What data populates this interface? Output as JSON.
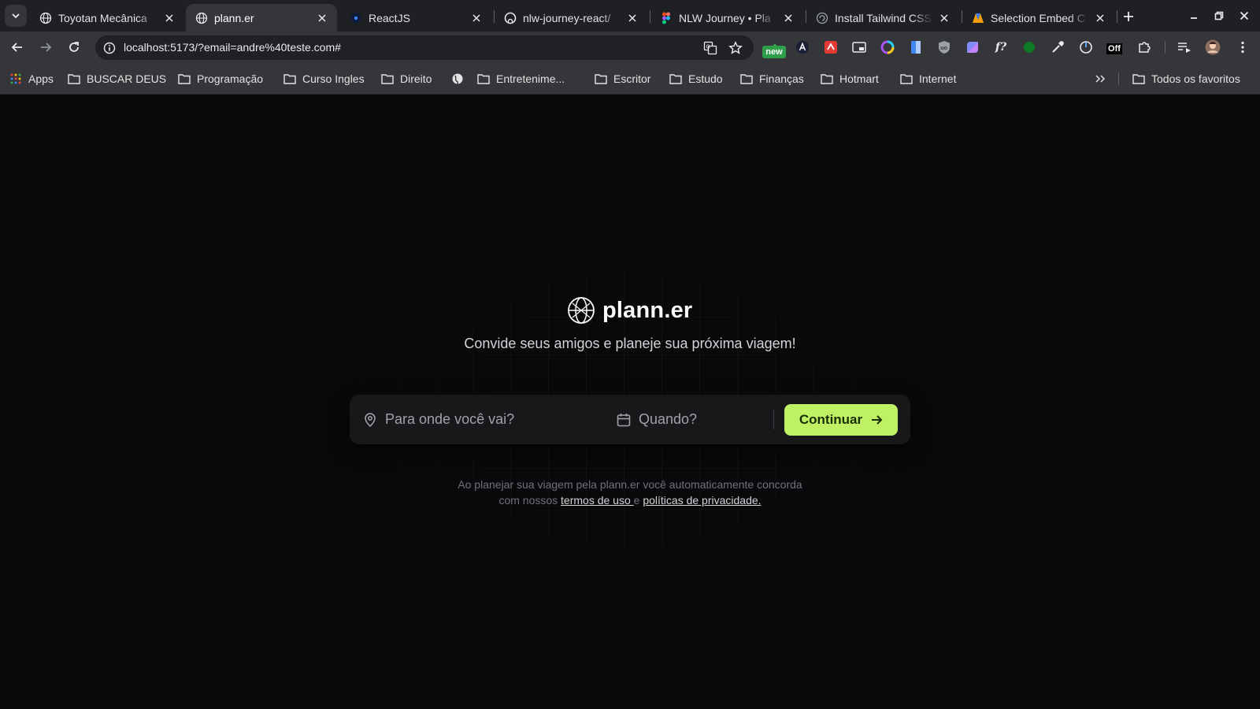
{
  "browser": {
    "tabs": [
      {
        "title": "Toyotan Mecânica",
        "favicon": "globe-icon"
      },
      {
        "title": "plann.er",
        "favicon": "globe-icon",
        "active": true
      },
      {
        "title": "ReactJS",
        "favicon": "react-icon"
      },
      {
        "title": "nlw-journey-react/",
        "favicon": "github-icon"
      },
      {
        "title": "NLW Journey • Pla",
        "favicon": "figma-icon"
      },
      {
        "title": "Install Tailwind CSS",
        "favicon": "globe-icon"
      },
      {
        "title": "Selection Embed C",
        "favicon": "app-icon"
      }
    ],
    "url": "localhost:5173/?email=andre%40teste.com#",
    "extension_badge": "new",
    "extension_off_badge": "Off",
    "bookmarks": [
      {
        "label": "Apps",
        "icon": "apps-grid-icon"
      },
      {
        "label": "BUSCAR DEUS",
        "icon": "folder-icon"
      },
      {
        "label": "Programação",
        "icon": "folder-icon"
      },
      {
        "label": "Curso Ingles",
        "icon": "folder-icon"
      },
      {
        "label": "Direito",
        "icon": "folder-icon"
      },
      {
        "label": "",
        "icon": "globe-icon"
      },
      {
        "label": "Entretenime...",
        "icon": "folder-icon"
      },
      {
        "label": "Escritor",
        "icon": "folder-icon"
      },
      {
        "label": "Estudo",
        "icon": "folder-icon"
      },
      {
        "label": "Finanças",
        "icon": "folder-icon"
      },
      {
        "label": "Hotmart",
        "icon": "folder-icon"
      },
      {
        "label": "Internet",
        "icon": "folder-icon"
      }
    ],
    "all_bookmarks": "Todos os favoritos"
  },
  "app": {
    "name": "plann.er",
    "subtitle": "Convide seus amigos e planeje sua próxima viagem!",
    "destination_placeholder": "Para onde você vai?",
    "date_placeholder": "Quando?",
    "continue_label": "Continuar",
    "terms_line1": "Ao planejar sua viagem pela plann.er você automaticamente concorda",
    "terms_prefix": "com nossos ",
    "terms_link": "termos de uso ",
    "terms_and": "e ",
    "privacy_link": "políticas de privacidade.",
    "accent_color": "#bef264",
    "background_color": "#09090b"
  }
}
